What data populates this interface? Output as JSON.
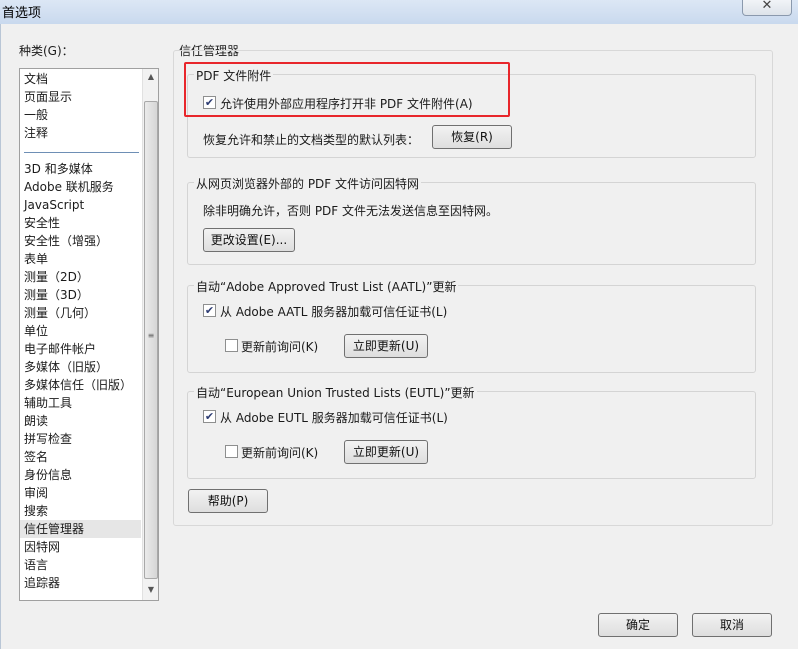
{
  "window": {
    "title": "首选项",
    "close_glyph": "✕"
  },
  "categories": {
    "label": "种类(G)：",
    "group1": [
      "文档",
      "页面显示",
      "一般",
      "注释"
    ],
    "group2": [
      "3D 和多媒体",
      "Adobe 联机服务",
      "JavaScript",
      "安全性",
      "安全性（增强）",
      "表单",
      "测量（2D）",
      "测量（3D）",
      "测量（几何）",
      "单位",
      "电子邮件帐户",
      "多媒体（旧版）",
      "多媒体信任（旧版）",
      "辅助工具",
      "朗读",
      "拼写检查",
      "签名",
      "身份信息",
      "审阅",
      "搜索",
      "信任管理器",
      "因特网",
      "语言",
      "追踪器"
    ],
    "selected": "信任管理器",
    "scroll_up_icon": "up-arrow-icon",
    "scroll_down_icon": "down-arrow-icon",
    "scroll_grip_glyph": "≡"
  },
  "trust_manager": {
    "title": "信任管理器",
    "pdf_attachments": {
      "title": "PDF 文件附件",
      "allow_external_label": "允许使用外部应用程序打开非 PDF 文件附件(A)",
      "allow_external_checked": true,
      "restore_text": "恢复允许和禁止的文档类型的默认列表：",
      "restore_button": "恢复(R)"
    },
    "internet_access": {
      "title": "从网页浏览器外部的 PDF 文件访问因特网",
      "description": "除非明确允许，否则 PDF 文件无法发送信息至因特网。",
      "change_settings_button": "更改设置(E)..."
    },
    "aatl": {
      "title": "自动“Adobe Approved Trust List (AATL)”更新",
      "load_label": "从 Adobe AATL 服务器加载可信任证书(L)",
      "load_checked": true,
      "ask_label": "更新前询问(K)",
      "ask_checked": false,
      "update_button": "立即更新(U)"
    },
    "eutl": {
      "title": "自动“European Union Trusted Lists (EUTL)”更新",
      "load_label": "从 Adobe EUTL 服务器加载可信任证书(L)",
      "load_checked": true,
      "ask_label": "更新前询问(K)",
      "ask_checked": false,
      "update_button": "立即更新(U)"
    },
    "help_button": "帮助(P)"
  },
  "footer": {
    "ok_button": "确定",
    "cancel_button": "取消"
  },
  "colors": {
    "highlight": "#e8262b",
    "selected_row": "#e6e6e6"
  }
}
